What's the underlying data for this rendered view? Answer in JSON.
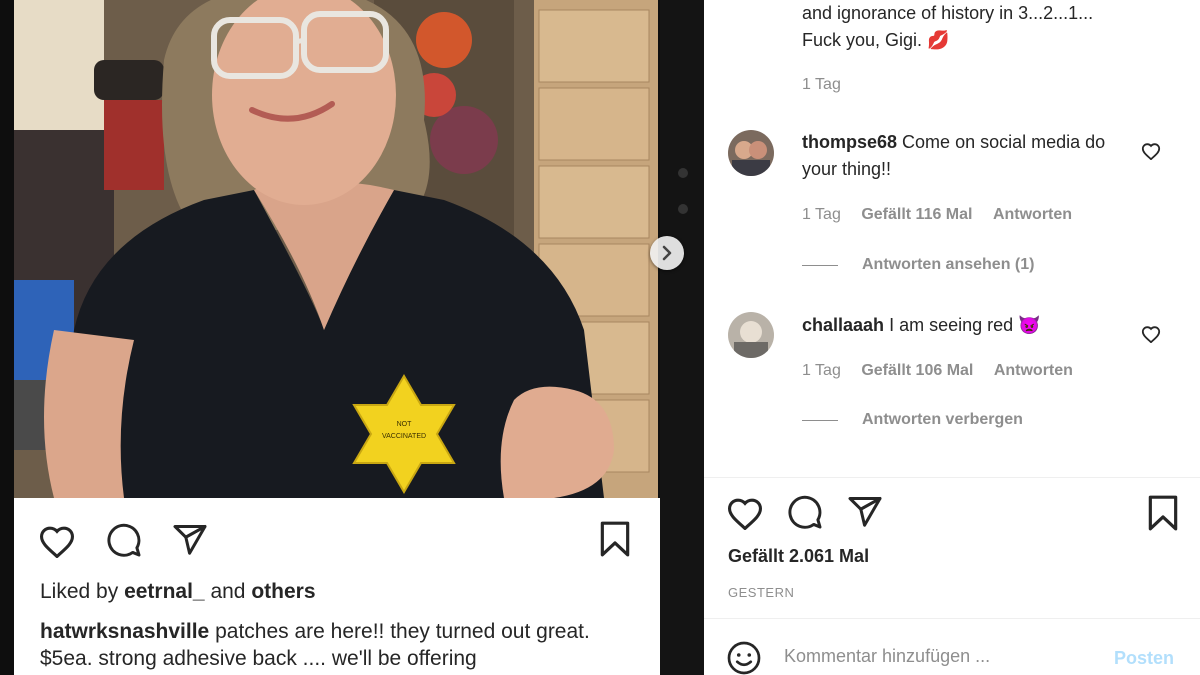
{
  "left_post": {
    "photo_alt": "Woman in black top holding yellow star patch",
    "patch_text": [
      "NOT",
      "VACCINATED"
    ],
    "liked_by_prefix": "Liked by",
    "liked_by_user": "eetrnal_",
    "liked_by_and": "and",
    "liked_by_others": "others",
    "caption_user": "hatwrksnashville",
    "caption_text": "patches are here!! they turned out great. $5ea. strong adhesive back .... we'll be offering"
  },
  "icons": {
    "like": "heart-icon",
    "comment": "comment-icon",
    "share": "share-icon",
    "save": "bookmark-icon",
    "next": "chevron-right-icon",
    "emoji": "smiley-icon"
  },
  "comment_pane": {
    "top_comment": {
      "line1": "and ignorance of history in 3...2...1...",
      "line2": "Fuck you, Gigi.",
      "emoji": "💋",
      "time": "1 Tag"
    },
    "comments": [
      {
        "user": "thompse68",
        "text": "Come on social media do your thing!!",
        "time": "1 Tag",
        "likes": "Gefällt 116 Mal",
        "reply": "Antworten",
        "replies_toggle": "Antworten ansehen (1)"
      },
      {
        "user": "challaaah",
        "text": "I am seeing red",
        "emoji": "👿",
        "time": "1 Tag",
        "likes": "Gefällt 106 Mal",
        "reply": "Antworten",
        "replies_toggle": "Antworten verbergen"
      }
    ],
    "likes_count": "Gefällt 2.061 Mal",
    "post_date": "GESTERN",
    "comment_placeholder": "Kommentar hinzufügen ...",
    "post_label": "Posten"
  },
  "colors": {
    "text": "#262626",
    "muted": "#8e8e8e",
    "post_button_disabled": "#b2dffc",
    "patch_yellow": "#f2d21f",
    "shirt": "#171a20"
  }
}
